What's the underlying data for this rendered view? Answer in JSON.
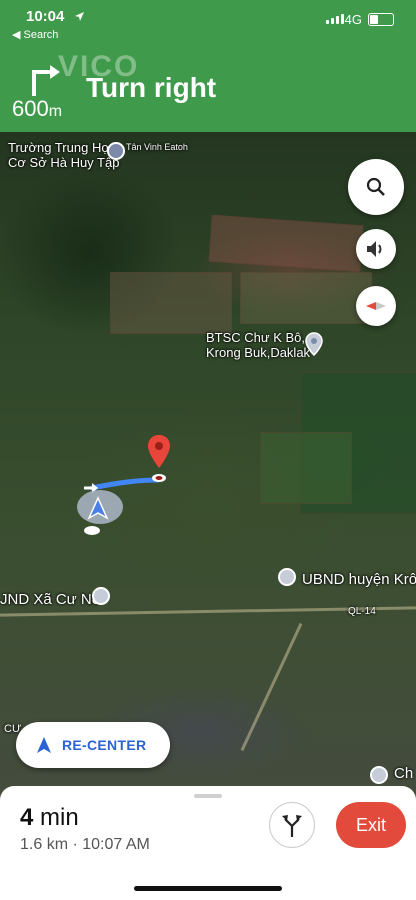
{
  "status_bar": {
    "time": "10:04",
    "back_label": "◀ Search",
    "network": "4G"
  },
  "nav": {
    "distance": "600",
    "distance_unit": "m",
    "instruction": "Turn right",
    "watermark": "VICO"
  },
  "map_labels": {
    "school": "Trường Trung Học\nCơ Sở Hà Huy Tập",
    "village": "Tân Vinh Eatoh",
    "btsc": "BTSC Chư K Bô,\nKrong Buk,Daklak",
    "ubnd_huyen": "UBND huyện Krôn",
    "ubnd_xa": "JND Xã Cư Né",
    "road": "QL-14",
    "partial_left": "CƯ",
    "partial_right": "Ch"
  },
  "buttons": {
    "recenter": "RE-CENTER",
    "exit": "Exit"
  },
  "eta": {
    "minutes": "4",
    "unit": "min",
    "detail": "1.6 km · 10:07 AM"
  },
  "colors": {
    "header_green": "#3f9a4b",
    "route_blue": "#4285f4",
    "exit_red": "#e24a3b",
    "recenter_blue": "#2b63d5"
  }
}
